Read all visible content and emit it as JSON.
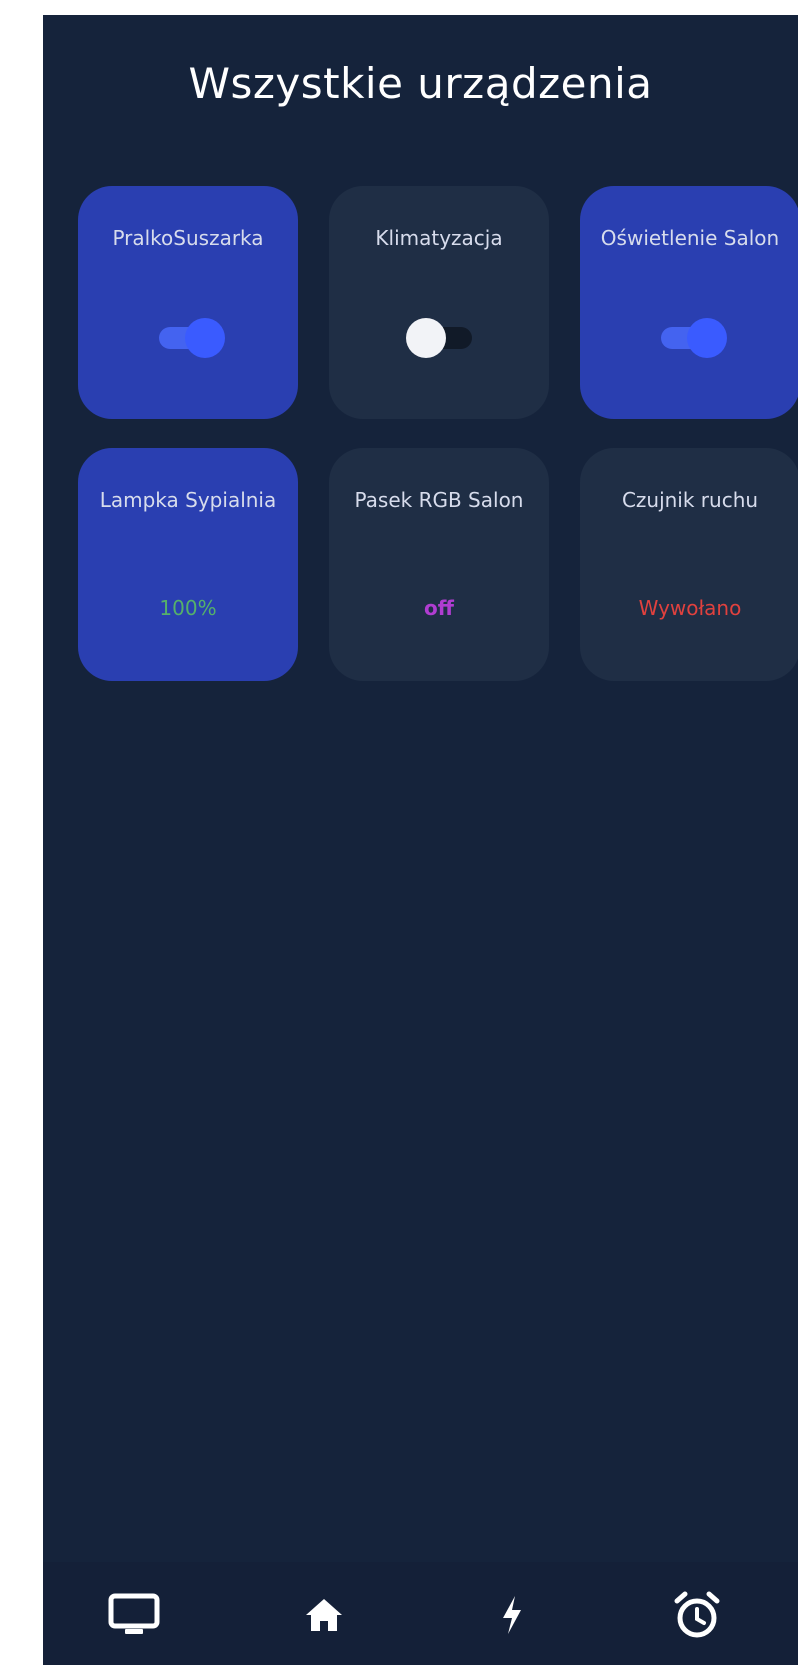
{
  "header": {
    "title": "Wszystkie urządzenia"
  },
  "devices": [
    {
      "name": "PralkoSuszarka",
      "type": "toggle",
      "state": true
    },
    {
      "name": "Klimatyzacja",
      "type": "toggle",
      "state": false
    },
    {
      "name": "Oświetlenie Salon",
      "type": "toggle",
      "state": true
    },
    {
      "name": "Lampka Sypialnia",
      "type": "value",
      "value": "100%",
      "value_color": "#55b06a",
      "active": true
    },
    {
      "name": "Pasek RGB Salon",
      "type": "value",
      "value": "off",
      "value_color": "#b03dd1",
      "active": false
    },
    {
      "name": "Czujnik ruchu",
      "type": "value",
      "value": "Wywołano",
      "value_color": "#e0413e",
      "active": false
    }
  ],
  "bottom_nav": {
    "items": [
      {
        "icon": "monitor-icon"
      },
      {
        "icon": "home-icon"
      },
      {
        "icon": "lightning-icon"
      },
      {
        "icon": "alarm-clock-icon"
      }
    ]
  },
  "colors": {
    "background": "#15233b",
    "tile_on": "#2a3fb1",
    "tile_off": "#1f2e45",
    "accent": "#3a5bff"
  }
}
